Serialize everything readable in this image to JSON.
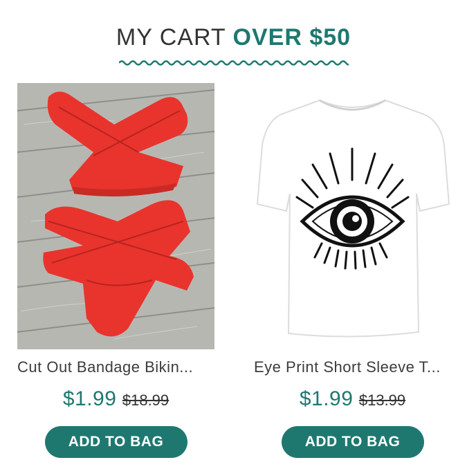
{
  "header": {
    "title_part1": "MY CART ",
    "title_part2": "OVER $50"
  },
  "colors": {
    "accent": "#1e7870",
    "text_dark": "#333333",
    "bikini_red": "#e8342d",
    "wood_gray": "#b9b9b4"
  },
  "products": [
    {
      "name": "Cut Out Bandage Bikin...",
      "price": "$1.99",
      "original_price": "$18.99",
      "button_label": "ADD TO BAG",
      "image_icon": "red-bikini-image"
    },
    {
      "name": "Eye Print Short Sleeve T...",
      "price": "$1.99",
      "original_price": "$13.99",
      "button_label": "ADD TO BAG",
      "image_icon": "eye-print-tshirt-image"
    }
  ]
}
